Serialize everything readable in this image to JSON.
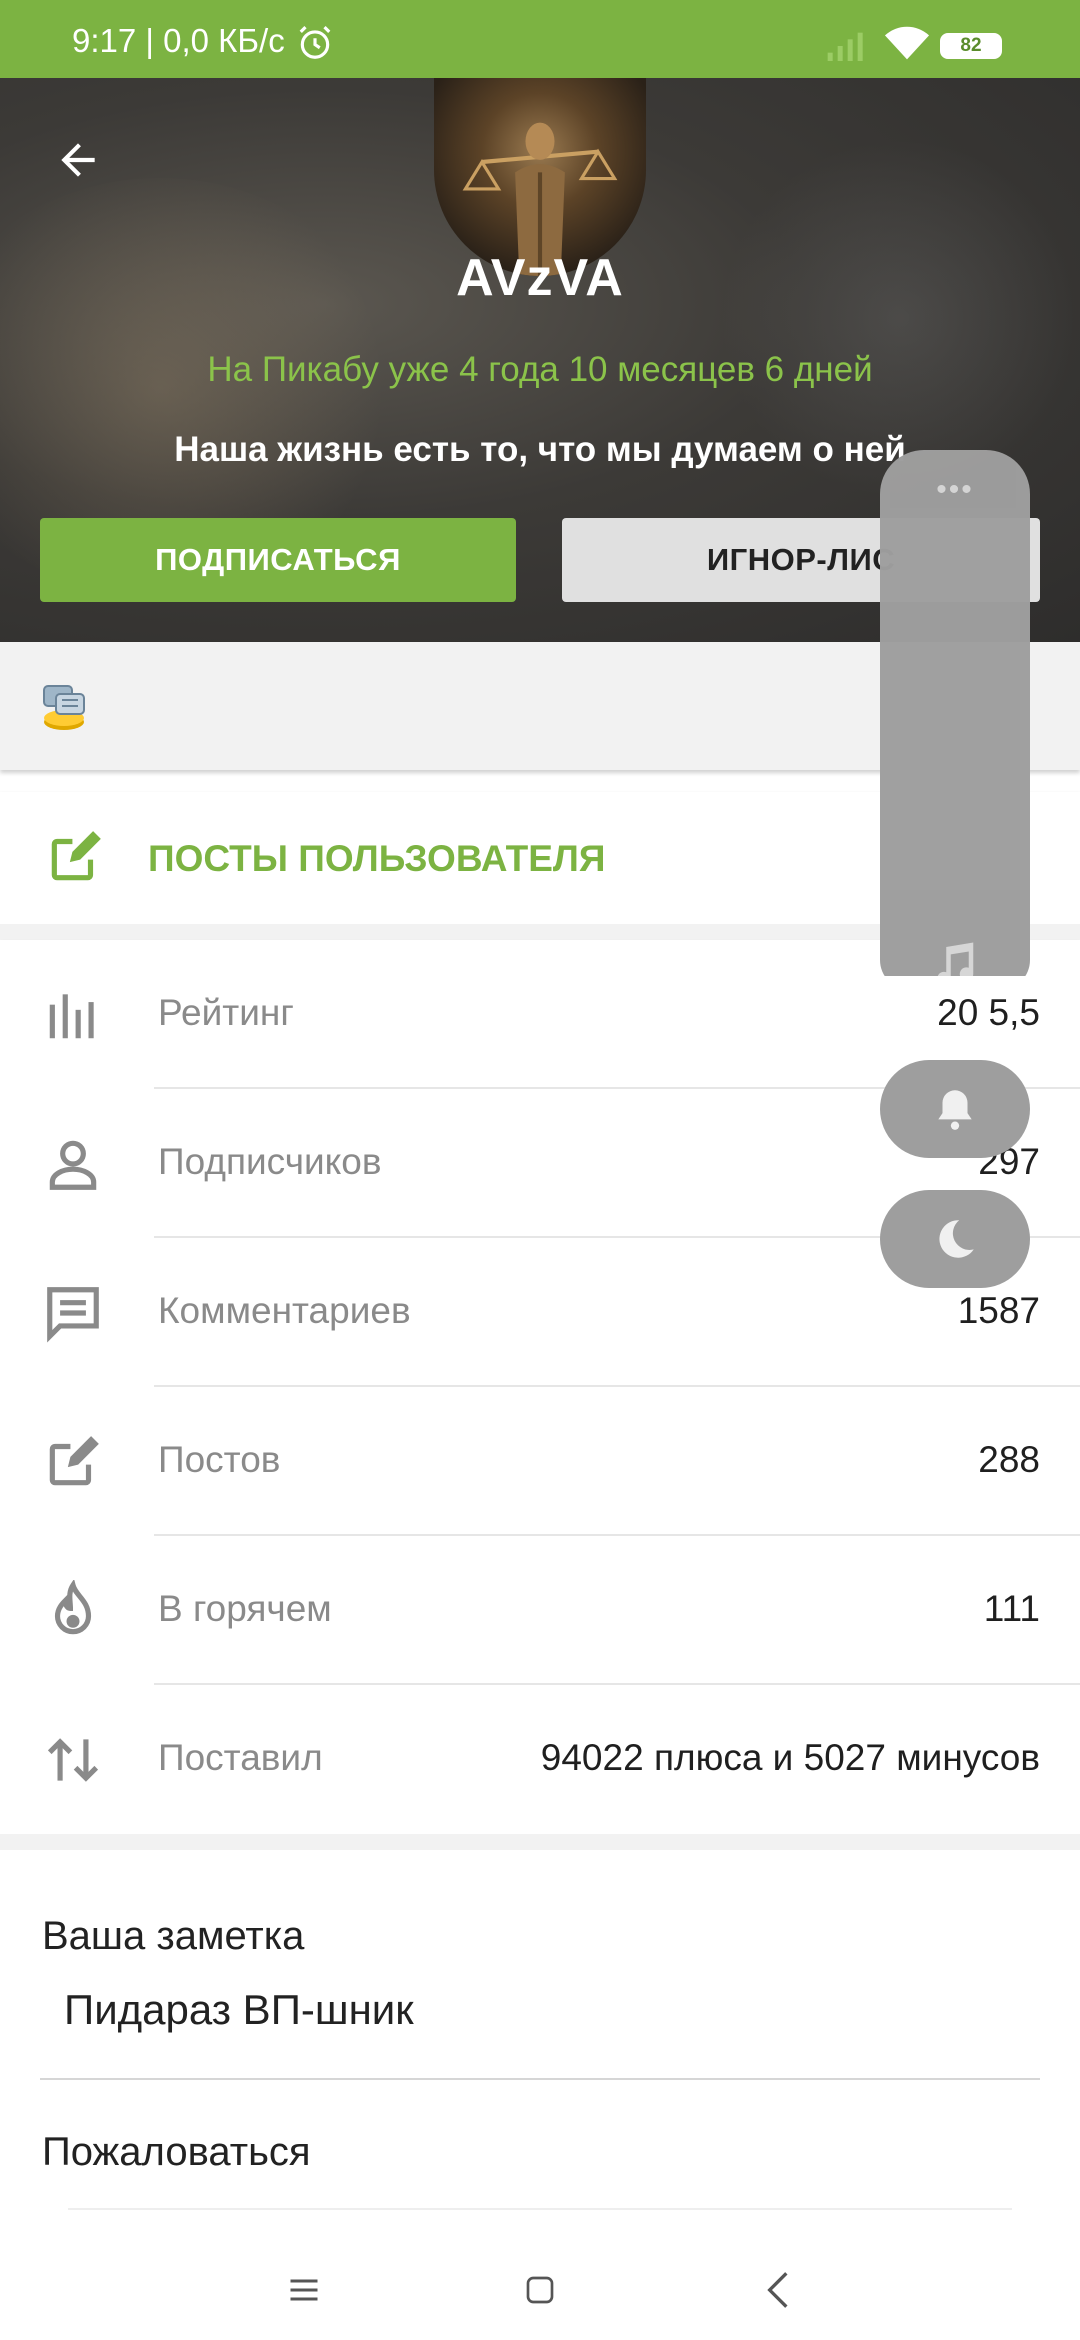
{
  "status_bar": {
    "time_text": "9:17 | 0,0 КБ/с",
    "battery": "82"
  },
  "profile": {
    "username": "AVzVA",
    "tenure": "На Пикабу уже 4 года 10 месяцев 6 дней",
    "bio": "Наша жизнь есть то, что мы думаем о ней",
    "subscribe_label": "ПОДПИСАТЬСЯ",
    "ignore_label": "ИГНОР-ЛИС"
  },
  "posts_link": {
    "label": "ПОСТЫ ПОЛЬЗОВАТЕЛЯ"
  },
  "stats": [
    {
      "label": "Рейтинг",
      "value": "20     5,5",
      "icon": "bar-chart-icon"
    },
    {
      "label": "Подписчиков",
      "value": "297",
      "icon": "person-icon"
    },
    {
      "label": "Комментариев",
      "value": "1587",
      "icon": "comment-icon"
    },
    {
      "label": "Постов",
      "value": "288",
      "icon": "edit-icon"
    },
    {
      "label": "В горячем",
      "value": "111",
      "icon": "fire-icon"
    },
    {
      "label": "Поставил",
      "value": "94022 плюса и 5027 минусов",
      "icon": "swap-vertical-icon"
    }
  ],
  "note": {
    "title": "Ваша заметка",
    "value": "Пидараз ВП-шник"
  },
  "report_label": "Пожаловаться",
  "floating_panel": {
    "dots": "•••"
  },
  "colors": {
    "accent": "#7cb342",
    "status_bar": "#7cb342",
    "panel_gray": "#9e9e9e"
  }
}
